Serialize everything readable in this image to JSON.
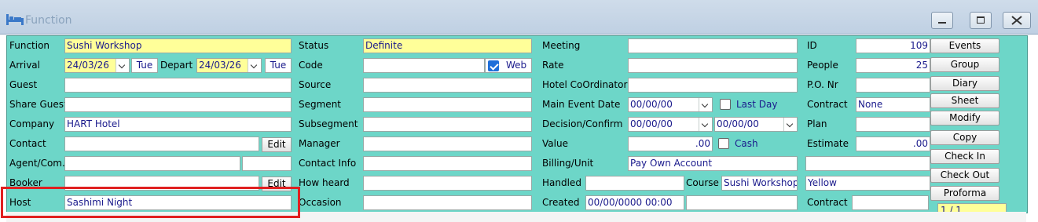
{
  "window": {
    "title": "Function",
    "icon": "bed-icon"
  },
  "colors": {
    "panel": "#6dd6c8",
    "required": "#ffff99",
    "value_text": "#1a1a8c",
    "highlight": "#e02020"
  },
  "col1": {
    "function_label": "Function",
    "function_value": "Sushi Workshop",
    "arrival_label": "Arrival",
    "arrival_value": "24/03/26",
    "arrival_day": "Tue",
    "depart_label": "Depart",
    "depart_value": "24/03/26",
    "depart_day": "Tue",
    "guest_label": "Guest",
    "guest_value": "",
    "share_guest_label": "Share Guest",
    "share_guest_value": "",
    "company_label": "Company",
    "company_value": "HART Hotel",
    "contact_label": "Contact",
    "contact_value": "",
    "contact_edit": "Edit",
    "agent_label": "Agent/Com.",
    "agent_value": "",
    "agent_com_value": "",
    "booker_label": "Booker",
    "booker_value": "",
    "booker_edit": "Edit",
    "host_label": "Host",
    "host_value": "Sashimi Night"
  },
  "col2": {
    "status_label": "Status",
    "status_value": "Definite",
    "code_label": "Code",
    "code_value": "",
    "web_label": "Web",
    "web_checked": true,
    "source_label": "Source",
    "source_value": "",
    "segment_label": "Segment",
    "segment_value": "",
    "subsegment_label": "Subsegment",
    "subsegment_value": "",
    "manager_label": "Manager",
    "manager_value": "",
    "contact_info_label": "Contact Info",
    "contact_info_value": "",
    "how_heard_label": "How heard",
    "how_heard_value": "",
    "occasion_label": "Occasion",
    "occasion_value": ""
  },
  "col3": {
    "meeting_label": "Meeting",
    "meeting_value": "",
    "rate_label": "Rate",
    "rate_value": "",
    "hotel_coord_label": "Hotel CoOrdinator",
    "hotel_coord_value": "",
    "main_event_label": "Main Event Date",
    "main_event_value": "00/00/00",
    "last_day_label": "Last Day",
    "last_day_checked": false,
    "decision_label": "Decision/Confirm",
    "decision_value": "00/00/00",
    "confirm_value": "00/00/00",
    "value_label": "Value",
    "value_value": ".00",
    "cash_label": "Cash",
    "cash_checked": false,
    "billing_label": "Billing/Unit",
    "billing_value": "Pay Own Account",
    "handled_label": "Handled",
    "handled_value": "",
    "course_label": "Course",
    "course_value": "Sushi Workshop",
    "created_label": "Created",
    "created_value": "00/00/0000 00:00",
    "created_by_value": ""
  },
  "col4": {
    "id_label": "ID",
    "id_value": "109",
    "people_label": "People",
    "people_value": "25",
    "po_label": "P.O. Nr",
    "po_value": "",
    "contract_label": "Contract",
    "contract_value": "None",
    "plan_label": "Plan",
    "plan_value": "",
    "estimate_label": "Estimate",
    "estimate_value": ".00",
    "colour_value": "",
    "yellow_value": "Yellow",
    "contract2_label": "Contract",
    "contract2_value": ""
  },
  "buttons": [
    "Events",
    "Group",
    "Diary",
    "Sheet",
    "Modify",
    "Copy",
    "Check In",
    "Check Out",
    "Proforma"
  ],
  "pager": "1 / 1"
}
